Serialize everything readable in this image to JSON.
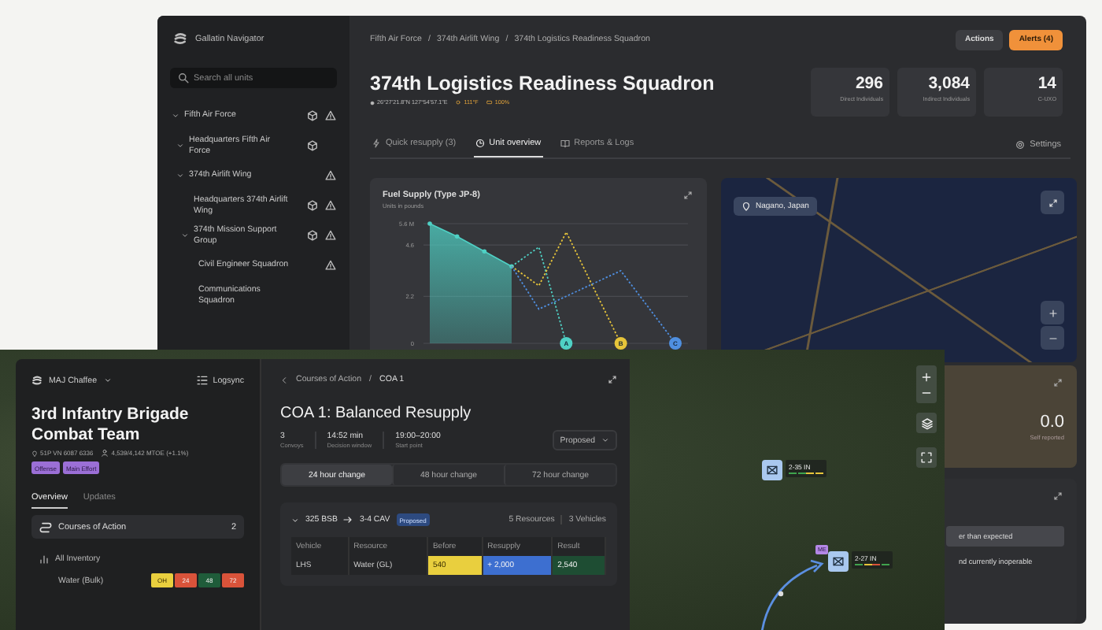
{
  "back_window": {
    "app_name": "Gallatin Navigator",
    "search": {
      "placeholder": "Search all units"
    },
    "tree": [
      {
        "label": "Fifth Air Force",
        "expanded": true,
        "supply": true,
        "alert": true,
        "children": [
          {
            "label": "Headquarters Fifth Air Force",
            "expanded": true,
            "supply": true,
            "alert": false
          },
          {
            "label": "374th Airlift Wing",
            "expanded": true,
            "supply": false,
            "alert": true,
            "children": [
              {
                "label": "Headquarters 374th Airlift Wing",
                "supply": true,
                "alert": true
              },
              {
                "label": "374th Mission Support Group",
                "expanded": true,
                "supply": true,
                "alert": true,
                "children": [
                  {
                    "label": "Civil Engineer Squadron",
                    "supply": false,
                    "alert": true
                  },
                  {
                    "label": "Communications Squadron",
                    "supply": false,
                    "alert": false
                  }
                ]
              }
            ]
          }
        ]
      }
    ],
    "breadcrumbs": [
      "Fifth Air Force",
      "374th Airlift Wing",
      "374th Logistics Readiness Squadron"
    ],
    "separator": "/",
    "buttons": [
      {
        "label": "Actions",
        "kind": "secondary"
      },
      {
        "label": "Alerts (4)",
        "kind": "primary"
      }
    ],
    "title": "374th Logistics Readiness Squadron",
    "location": {
      "coordinates": "26°27'21.8\"N 127°54'57.1\"E",
      "temperature": "111°F",
      "battery": "100%"
    },
    "stats": [
      {
        "value": "296",
        "label": "Direct Individuals"
      },
      {
        "value": "3,084",
        "label": "Indirect Individuals"
      },
      {
        "value": "14",
        "label": "C-UXO"
      }
    ],
    "tabs": [
      {
        "label": "Quick resupply (3)",
        "selected": false
      },
      {
        "label": "Unit overview",
        "selected": true
      },
      {
        "label": "Reports & Logs",
        "selected": false
      }
    ],
    "settings": "Settings",
    "fuel_card": {
      "title": "Fuel Supply (Type JP-8)",
      "subtitle": "Units in pounds",
      "chart_data": {
        "type": "line",
        "ylim": [
          0,
          5.6
        ],
        "yticks": [
          0,
          2.2,
          4.6,
          {
            "value": 5.6,
            "label": "5.6 M"
          }
        ],
        "series": [
          {
            "type": "area",
            "color": "#4fd1c5",
            "values": [
              5.6,
              5.0,
              4.3,
              3.6,
              null,
              null,
              null,
              null,
              null,
              null
            ]
          },
          {
            "name": "A",
            "line_style": "dashed",
            "color": "#4fd1c5",
            "values": [
              null,
              null,
              null,
              3.6,
              4.5,
              0,
              null,
              null,
              null,
              null
            ]
          },
          {
            "name": "B",
            "line_style": "dashed",
            "color": "#e6c43a",
            "values": [
              null,
              null,
              null,
              3.6,
              2.7,
              5.2,
              2.6,
              0,
              null,
              null
            ]
          },
          {
            "name": "C",
            "line_style": "dashed",
            "color": "#4f8fe0",
            "values": [
              null,
              null,
              null,
              3.6,
              1.6,
              2.2,
              2.8,
              3.4,
              1.7,
              0
            ]
          }
        ]
      }
    },
    "map_card": {
      "location": "Nagano, Japan"
    },
    "self_report_card": {
      "value": "0.0",
      "label": "Self reported"
    },
    "issues_card": {
      "rows": [
        {
          "text": "er than expected",
          "highlighted": true
        },
        {
          "text": "nd currently inoperable",
          "highlighted": false
        }
      ]
    }
  },
  "front_window": {
    "user": "MAJ Chaffee",
    "sync": "Logsync",
    "unit_title": "3rd Infantry Brigade Combat Team",
    "grid_ref": "51P VN 6087 6336",
    "strength": "4,539/4,142 MTOE (+1.1%)",
    "tags": [
      "Offense",
      "Main Effort"
    ],
    "tabs": [
      {
        "label": "Overview",
        "selected": true
      },
      {
        "label": "Updates",
        "selected": false
      }
    ],
    "coa_link": {
      "label": "Courses of Action",
      "count": "2"
    },
    "inventory": {
      "label": "All Inventory",
      "rows": [
        {
          "name": "Water (Bulk)",
          "cells": [
            {
              "text": "OH",
              "color": "#e9cf3e"
            },
            {
              "text": "24",
              "color": "#d9533a"
            },
            {
              "text": "48",
              "color": "#1f5c3a"
            },
            {
              "text": "72",
              "color": "#d9533a"
            }
          ]
        }
      ]
    }
  },
  "coa": {
    "breadcrumbs": [
      "Courses of Action",
      "COA 1"
    ],
    "separator": "/",
    "title": "COA 1: Balanced Resupply",
    "stats": [
      {
        "value": "3",
        "label": "Convoys"
      },
      {
        "value": "14:52 min",
        "label": "Decision window"
      },
      {
        "value": "19:00–20:00",
        "label": "Start point"
      }
    ],
    "status": "Proposed",
    "periods": [
      {
        "label": "24 hour change",
        "selected": true
      },
      {
        "label": "48 hour change",
        "selected": false
      },
      {
        "label": "72 hour change",
        "selected": false
      }
    ],
    "convoy": {
      "expanded": true,
      "from": "325 BSB",
      "to": "3-4 CAV",
      "status": "Proposed",
      "resources": "5 Resources",
      "vehicles": "3 Vehicles",
      "columns": [
        "Vehicle",
        "Resource",
        "Before",
        "Resupply",
        "Result"
      ],
      "rows": [
        {
          "cells": [
            {
              "text": "LHS"
            },
            {
              "text": "Water (GL)"
            },
            {
              "text": "540",
              "color": "#e9cf3e"
            },
            {
              "text": "+ 2,000",
              "color": "#3d6fd0"
            },
            {
              "text": "2,540",
              "color": "#1e4d33"
            }
          ]
        }
      ]
    }
  },
  "map": {
    "units": [
      {
        "label": "2-35 IN",
        "status": [
          {
            "color": "#3fa34d"
          },
          {
            "color": "#3fa34d"
          },
          {
            "color": "#e6c43a"
          },
          {
            "color": "#e6c43a"
          }
        ]
      },
      {
        "label": "2-27 IN",
        "badge": "ME",
        "status": [
          {
            "color": "#3fa34d"
          },
          {
            "color": "#e6c43a"
          },
          {
            "color": "#d9533a"
          },
          {
            "color": "#3fa34d"
          }
        ]
      }
    ]
  }
}
